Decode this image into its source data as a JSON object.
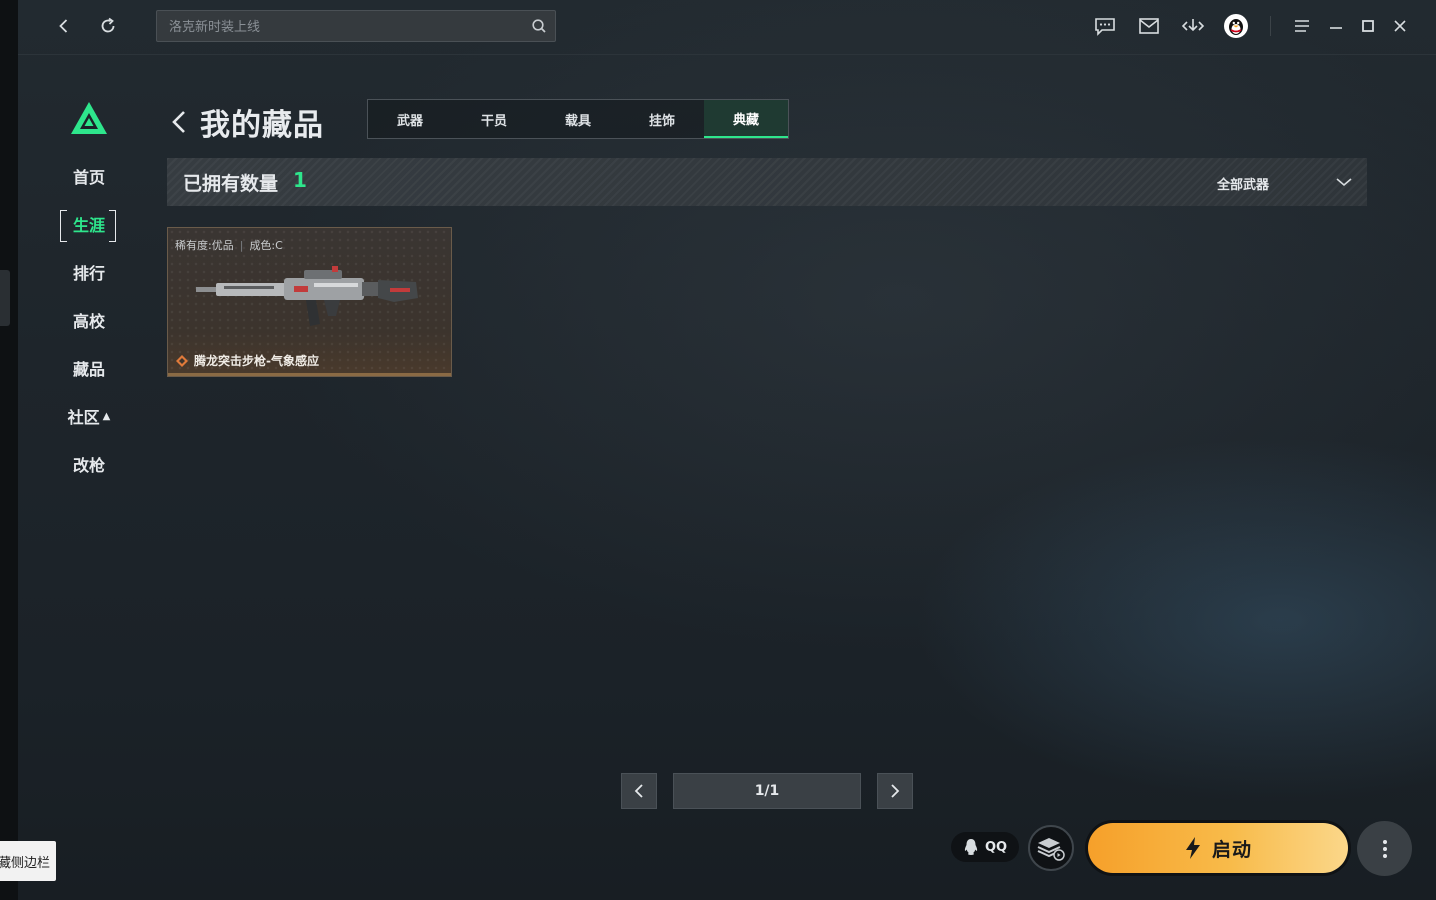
{
  "topbar": {
    "search_placeholder": "洛克新时装上线"
  },
  "nav": {
    "items": [
      {
        "label": "首页"
      },
      {
        "label": "生涯"
      },
      {
        "label": "排行"
      },
      {
        "label": "高校"
      },
      {
        "label": "藏品"
      },
      {
        "label": "社区"
      },
      {
        "label": "改枪"
      }
    ]
  },
  "header": {
    "title": "我的藏品",
    "tabs": [
      {
        "label": "武器"
      },
      {
        "label": "干员"
      },
      {
        "label": "载具"
      },
      {
        "label": "挂饰"
      },
      {
        "label": "典藏"
      }
    ],
    "active_tab": "典藏"
  },
  "owned": {
    "label": "已拥有数量",
    "count": "1",
    "filter_label": "全部武器"
  },
  "items": [
    {
      "rarity": "稀有度:优品",
      "condition": "成色:C",
      "name": "腾龙突击步枪-气象感应"
    }
  ],
  "pagination": {
    "text": "1/1"
  },
  "footer": {
    "qq_label": "QQ",
    "launch_label": "启动",
    "sidebar_tooltip": "隐藏侧边栏"
  },
  "colors": {
    "accent": "#2ee68c",
    "launch": "#f8bb4a",
    "rarity": "#e07a3a"
  }
}
